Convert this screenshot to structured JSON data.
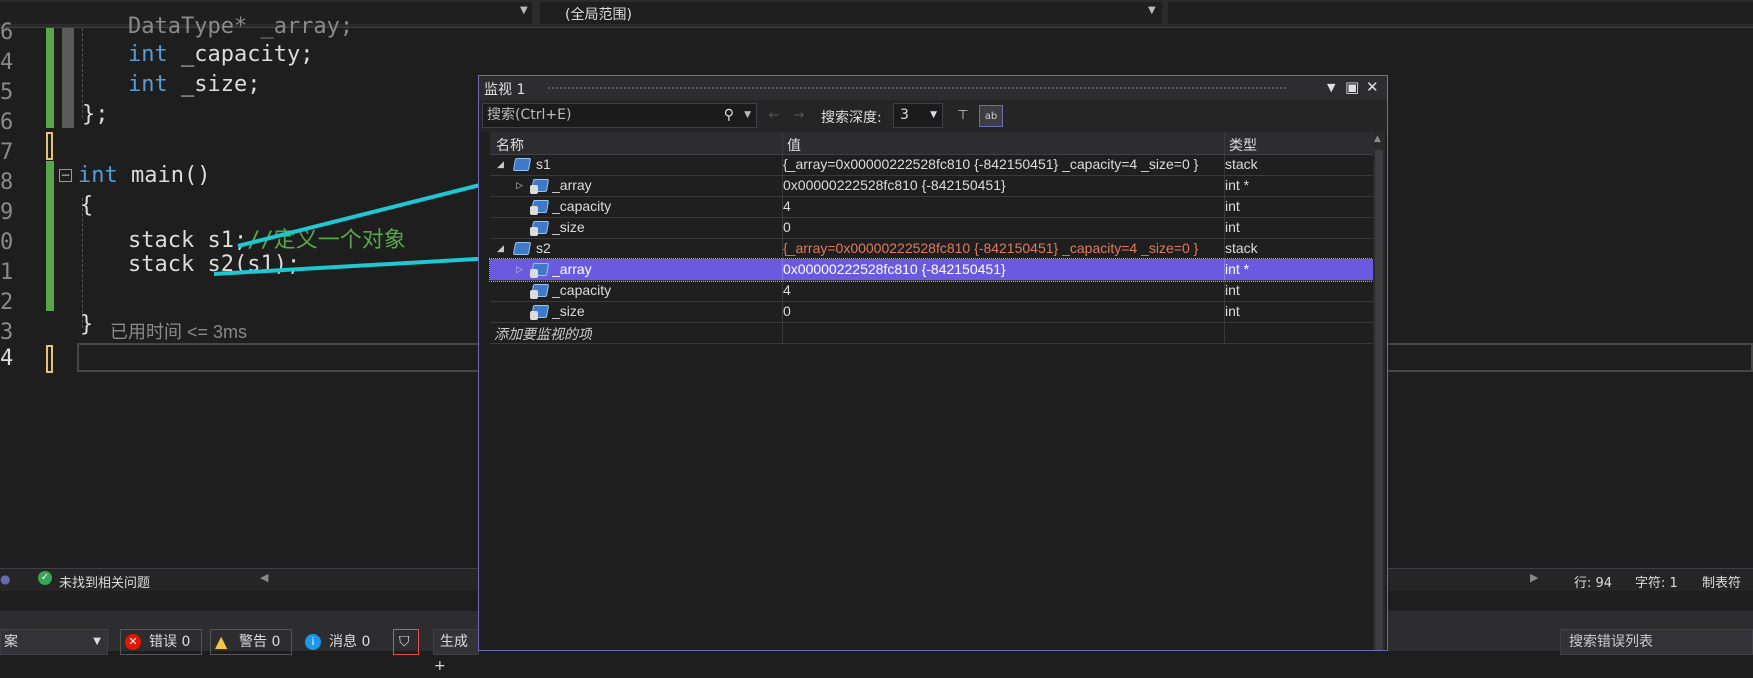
{
  "topbar": {
    "scope": "(全局范围)"
  },
  "editor": {
    "line_numbers": [
      "6",
      "4",
      "5",
      "6",
      "7",
      "8",
      "9",
      "0",
      "1",
      "2",
      "3",
      "4"
    ],
    "line1_partial": "DataType* _array;",
    "line2_kw": "int",
    "line2_rest": " _capacity;",
    "line3_kw": "int",
    "line3_rest": " _size;",
    "line4": "};",
    "line6_kw": "int",
    "line6_rest": " main()",
    "line7": "{",
    "line8_code": "stack s1;",
    "line8_comment": "//定义一个对象",
    "line9_code": "stack s2(s1);",
    "line11_brace": "}",
    "elapsed_hint": "已用时间 <= 3ms"
  },
  "watch": {
    "title": "监视 1",
    "search_placeholder": "搜索(Ctrl+E)",
    "depth_label": "搜索深度:",
    "depth_value": "3",
    "columns": {
      "name": "名称",
      "value": "值",
      "type": "类型"
    },
    "rows": [
      {
        "name": "s1",
        "value": "{_array=0x00000222528fc810 {-842150451} _capacity=4 _size=0 }",
        "type": "stack"
      },
      {
        "name": "_array",
        "value": "0x00000222528fc810 {-842150451}",
        "type": "int *"
      },
      {
        "name": "_capacity",
        "value": "4",
        "type": "int"
      },
      {
        "name": "_size",
        "value": "0",
        "type": "int"
      },
      {
        "name": "s2",
        "value": "{_array=0x00000222528fc810 {-842150451} _capacity=4 _size=0 }",
        "type": "stack"
      },
      {
        "name": "_array",
        "value": "0x00000222528fc810 {-842150451}",
        "type": "int *"
      },
      {
        "name": "_capacity",
        "value": "4",
        "type": "int"
      },
      {
        "name": "_size",
        "value": "0",
        "type": "int"
      }
    ],
    "add_item": "添加要监视的项"
  },
  "status": {
    "no_issues": "未找到相关问题",
    "line": "行: 94",
    "char": "字符: 1",
    "tabs": "制表符"
  },
  "errorlist": {
    "scope_partial": "案",
    "errors": "错误 0",
    "warnings": "警告 0",
    "messages": "消息 0",
    "build": "生成 +",
    "search": "搜索错误列表"
  },
  "colors": {
    "accent_selection": "#6b59e0",
    "arrow": "#1ec8d2",
    "window_border": "#6c6cb4",
    "keyword": "#569cd6",
    "comment": "#57a64a",
    "changed_value": "#e07a5f"
  }
}
